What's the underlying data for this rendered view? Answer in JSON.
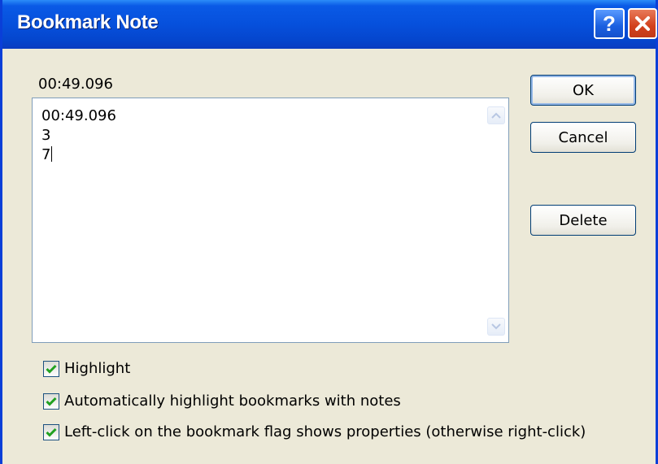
{
  "window": {
    "title": "Bookmark Note"
  },
  "titlebar": {
    "help_label": "?"
  },
  "time_label": "00:49.096",
  "note": {
    "lines": [
      "00:49.096",
      "3",
      "7"
    ]
  },
  "buttons": {
    "ok": "OK",
    "cancel": "Cancel",
    "delete": "Delete"
  },
  "options": [
    {
      "label": "Highlight",
      "checked": true
    },
    {
      "label": "Automatically highlight bookmarks with notes",
      "checked": true
    },
    {
      "label": "Left-click on the bookmark flag shows properties (otherwise right-click)",
      "checked": true
    }
  ],
  "colors": {
    "title_bar": "#0650dc",
    "close_button": "#d2401c",
    "dialog_bg": "#ece9d8",
    "checkmark": "#21a121"
  },
  "icons": {
    "help": "help-icon",
    "close": "close-icon",
    "scroll_up": "scroll-up-arrow-icon",
    "scroll_down": "scroll-down-arrow-icon",
    "check": "checkmark-icon"
  }
}
